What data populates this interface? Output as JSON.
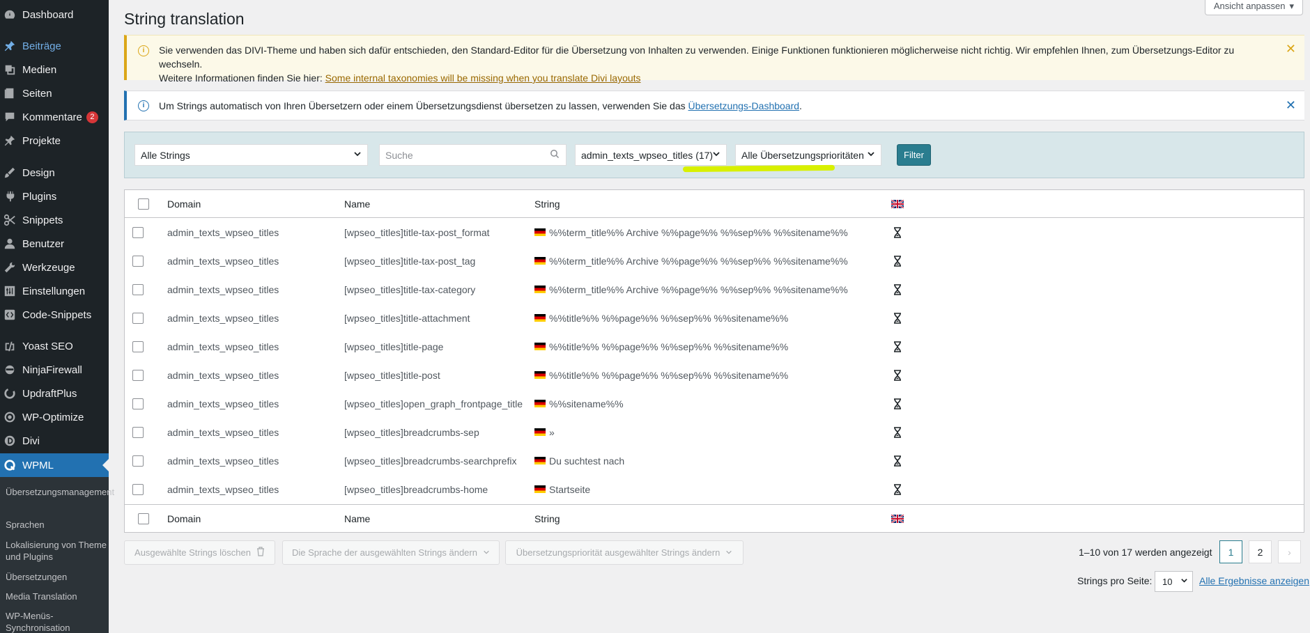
{
  "sidebar": {
    "items": [
      {
        "label": "Dashboard",
        "icon": "dashboard-icon"
      },
      {
        "label": "Beiträge",
        "icon": "pin-icon"
      },
      {
        "label": "Medien",
        "icon": "media-icon"
      },
      {
        "label": "Seiten",
        "icon": "page-icon"
      },
      {
        "label": "Kommentare",
        "icon": "comment-icon",
        "badge": "2"
      },
      {
        "label": "Projekte",
        "icon": "pin-icon"
      },
      {
        "label": "Design",
        "icon": "brush-icon"
      },
      {
        "label": "Plugins",
        "icon": "plugin-icon"
      },
      {
        "label": "Snippets",
        "icon": "snippets-icon"
      },
      {
        "label": "Benutzer",
        "icon": "user-icon"
      },
      {
        "label": "Werkzeuge",
        "icon": "wrench-icon"
      },
      {
        "label": "Einstellungen",
        "icon": "settings-icon"
      },
      {
        "label": "Code-Snippets",
        "icon": "code-icon"
      },
      {
        "label": "Yoast SEO",
        "icon": "yoast-icon"
      },
      {
        "label": "NinjaFirewall",
        "icon": "ninja-icon"
      },
      {
        "label": "UpdraftPlus",
        "icon": "updraft-icon"
      },
      {
        "label": "WP-Optimize",
        "icon": "optimize-icon"
      },
      {
        "label": "Divi",
        "icon": "divi-icon"
      },
      {
        "label": "WPML",
        "icon": "wpml-icon"
      }
    ],
    "submenu": [
      "Übersetzungsmanagement",
      "Sprachen",
      "Lokalisierung von Theme und Plugins",
      "Übersetzungen",
      "Media Translation",
      "WP-Menüs-Synchronisation"
    ]
  },
  "header": {
    "title": "String translation",
    "screen_options": "Ansicht anpassen"
  },
  "notices": {
    "warning_text": "Sie verwenden das DIVI-Theme und haben sich dafür entschieden, den Standard-Editor für die Übersetzung von Inhalten zu verwenden. Einige Funktionen funktionieren möglicherweise nicht richtig. Wir empfehlen Ihnen, zum Übersetzungs-Editor zu wechseln.",
    "warning_more": "Weitere Informationen finden Sie hier: ",
    "warning_link": "Some internal taxonomies will be missing when you translate Divi layouts",
    "info_text": "Um Strings automatisch von Ihren Übersetzern oder einem Übersetzungsdienst übersetzen zu lassen, verwenden Sie das ",
    "info_link": "Übersetzungs-Dashboard",
    "info_end": "."
  },
  "filters": {
    "status": "Alle Strings",
    "search_placeholder": "Suche",
    "domain": "admin_texts_wpseo_titles (17)",
    "priority": "Alle Übersetzungsprioritäten",
    "button": "Filter"
  },
  "table": {
    "headers": {
      "domain": "Domain",
      "name": "Name",
      "string": "String"
    },
    "rows": [
      {
        "domain": "admin_texts_wpseo_titles",
        "name": "[wpseo_titles]title-tax-post_format",
        "string": "%%term_title%% Archive %%page%% %%sep%% %%sitename%%"
      },
      {
        "domain": "admin_texts_wpseo_titles",
        "name": "[wpseo_titles]title-tax-post_tag",
        "string": "%%term_title%% Archive %%page%% %%sep%% %%sitename%%"
      },
      {
        "domain": "admin_texts_wpseo_titles",
        "name": "[wpseo_titles]title-tax-category",
        "string": "%%term_title%% Archive %%page%% %%sep%% %%sitename%%"
      },
      {
        "domain": "admin_texts_wpseo_titles",
        "name": "[wpseo_titles]title-attachment",
        "string": "%%title%% %%page%% %%sep%% %%sitename%%"
      },
      {
        "domain": "admin_texts_wpseo_titles",
        "name": "[wpseo_titles]title-page",
        "string": "%%title%% %%page%% %%sep%% %%sitename%%"
      },
      {
        "domain": "admin_texts_wpseo_titles",
        "name": "[wpseo_titles]title-post",
        "string": "%%title%% %%page%% %%sep%% %%sitename%%"
      },
      {
        "domain": "admin_texts_wpseo_titles",
        "name": "[wpseo_titles]open_graph_frontpage_title",
        "string": "%%sitename%%"
      },
      {
        "domain": "admin_texts_wpseo_titles",
        "name": "[wpseo_titles]breadcrumbs-sep",
        "string": "»"
      },
      {
        "domain": "admin_texts_wpseo_titles",
        "name": "[wpseo_titles]breadcrumbs-searchprefix",
        "string": "Du suchtest nach"
      },
      {
        "domain": "admin_texts_wpseo_titles",
        "name": "[wpseo_titles]breadcrumbs-home",
        "string": "Startseite"
      }
    ]
  },
  "bulk": {
    "delete": "Ausgewählte Strings löschen",
    "language": "Die Sprache der ausgewählten Strings ändern",
    "priority": "Übersetzungspriorität ausgewählter Strings ändern"
  },
  "pagination": {
    "info": "1–10 von 17 werden angezeigt",
    "pages": [
      "1",
      "2"
    ],
    "next": "›",
    "per_page_label": "Strings pro Seite:",
    "per_page_value": "10",
    "show_all": "Alle Ergebnisse anzeigen"
  },
  "colors": {
    "sidebar": "#1d2327",
    "accent": "#2271b1",
    "filter_button": "#2a7d8f",
    "highlight": "#d8f000"
  }
}
